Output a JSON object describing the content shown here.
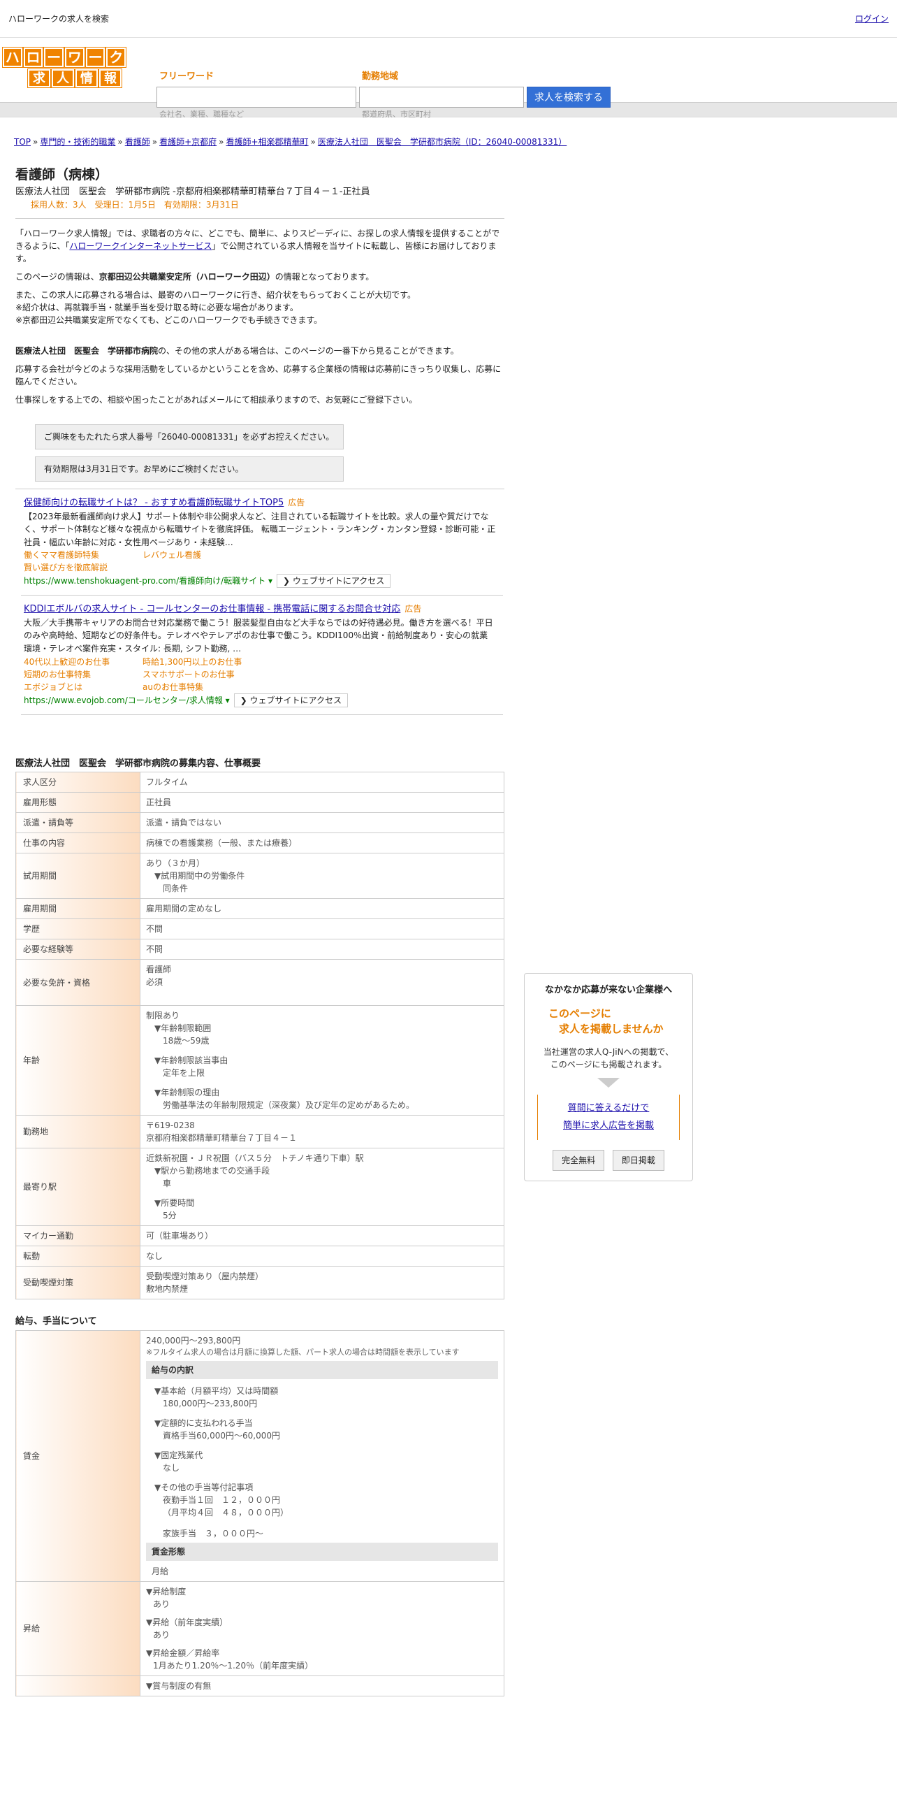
{
  "topbar": {
    "title": "ハローワークの求人を検索",
    "login": "ログイン"
  },
  "logo": {
    "row1": [
      "ハ",
      "ロ",
      "ー",
      "ワ",
      "ー",
      "ク"
    ],
    "row2": [
      "求",
      "人",
      "情",
      "報"
    ]
  },
  "search": {
    "keyword_label": "フリーワード",
    "keyword_hint": "会社名、業種、職種など",
    "area_label": "勤務地域",
    "area_hint": "都道府県、市区町村",
    "button": "求人を検索する"
  },
  "breadcrumb": [
    "TOP",
    "専門的・技術的職業",
    "看護師",
    "看護師+京都府",
    "看護師+相楽郡精華町",
    "医療法人社団　医聖会　学研都市病院（ID：26040-00081331）"
  ],
  "job": {
    "title": "看護師（病棟）",
    "company_line": "医療法人社団　医聖会　学研都市病院 -京都府相楽郡精華町精華台７丁目４－１-正社員",
    "meta": "採用人数：3人　受理日：1月5日　有効期限：3月31日"
  },
  "intro": {
    "p1a": "「ハローワーク求人情報」では、求職者の方々に、どこでも、簡単に、よりスピーディに、お探しの求人情報を提供することができるように、「",
    "p1link": "ハローワークインターネットサービス",
    "p1b": "」で公開されている求人情報を当サイトに転載し、皆様にお届けしております。",
    "p2a": "このページの情報は、",
    "p2b": "京都田辺公共職業安定所（ハローワーク田辺）",
    "p2c": "の情報となっております。",
    "p3": "また、この求人に応募される場合は、最寄のハローワークに行き、紹介状をもらっておくことが大切です。",
    "p4": "※紹介状は、再就職手当・就業手当を受け取る時に必要な場合があります。",
    "p5": "※京都田辺公共職業安定所でなくても、どこのハローワークでも手続きできます。",
    "p6a": "医療法人社団　医聖会　学研都市病院",
    "p6b": "の、その他の求人がある場合は、このページの一番下から見ることができます。",
    "p7": "応募する会社が今どのような採用活動をしているかということを含め、応募する企業様の情報は応募前にきっちり収集し、応募に臨んでください。",
    "p8": "仕事探しをする上での、相談や困ったことがあればメールにて相談承りますので、お気軽にご登録下さい。"
  },
  "notices": [
    "ご興味をもたれたら求人番号「26040-00081331」を必ずお控えください。",
    "有効期限は3月31日です。お早めにご検討ください。"
  ],
  "ads": [
    {
      "title": "保健師向けの転職サイトは？ - おすすめ看護師転職サイトTOP5",
      "tag": "広告",
      "desc": "【2023年最新看護師向け求人】サポート体制や非公開求人など、注目されている転職サイトを比較。求人の量や質だけでなく、サポート体制など様々な視点から転職サイトを徹底評価。 転職エージェント・ランキング・カンタン登録・診断可能・正社員・幅広い年齢に対応・女性用ページあり・未経験…",
      "links": [
        "働くママ看護師特集",
        "レバウェル看護",
        "賢い選び方を徹底解説"
      ],
      "url": "https://www.tenshokuagent-pro.com/看護師向け/転職サイト ▾",
      "button": "❯ ウェブサイトにアクセス"
    },
    {
      "title": "KDDIエボルバの求人サイト - コールセンターのお仕事情報 - 携帯電話に関するお問合せ対応",
      "tag": "広告",
      "desc": "大阪／大手携帯キャリアのお問合せ対応業務で働こう！服装髪型自由など大手ならではの好待遇必見。働き方を選べる！平日のみや高時給、短期などの好条件も。テレオペやテレアポのお仕事で働こう。KDDI100％出資・前給制度あり・安心の就業環境・テレオペ案件充実・スタイル: 長期, シフト勤務, …",
      "links": [
        "40代以上歓迎のお仕事",
        "時給1,300円以上のお仕事",
        "短期のお仕事特集",
        "スマホサポートのお仕事",
        "エボジョブとは",
        "auのお仕事特集"
      ],
      "url": "https://www.evojob.com/コールセンター/求人情報 ▾",
      "button": "❯ ウェブサイトにアクセス"
    }
  ],
  "section1": "医療法人社団　医聖会　学研都市病院の募集内容、仕事概要",
  "rows": {
    "r1": {
      "h": "求人区分",
      "v": "フルタイム"
    },
    "r2": {
      "h": "雇用形態",
      "v": "正社員"
    },
    "r3": {
      "h": "派遣・請負等",
      "v": "派遣・請負ではない"
    },
    "r4": {
      "h": "仕事の内容",
      "v": "病棟での看護業務（一般、または療養）"
    },
    "r5": {
      "h": "試用期間",
      "v": "あり（３か月）",
      "s1": "▼試用期間中の労働条件",
      "s2": "同条件"
    },
    "r6": {
      "h": "雇用期間",
      "v": "雇用期間の定めなし"
    },
    "r7": {
      "h": "学歴",
      "v": "不問"
    },
    "r8": {
      "h": "必要な経験等",
      "v": "不問"
    },
    "r9": {
      "h": "必要な免許・資格",
      "v": "看護師",
      "v2": "必須"
    },
    "r10": {
      "h": "年齢",
      "v": "制限あり",
      "s1": "▼年齢制限範囲",
      "s2": "18歳〜59歳",
      "s3": "▼年齢制限該当事由",
      "s4": "定年を上限",
      "s5": "▼年齢制限の理由",
      "s6": "労働基準法の年齢制限規定（深夜業）及び定年の定めがあるため。"
    },
    "r11": {
      "h": "勤務地",
      "v": "〒619-0238",
      "v2": "京都府相楽郡精華町精華台７丁目４－１"
    },
    "r12": {
      "h": "最寄り駅",
      "v": "近鉄新祝園・ＪＲ祝園（バス５分　トチノキ通り下車）駅",
      "s1": "▼駅から勤務地までの交通手段",
      "s2": "車",
      "s3": "▼所要時間",
      "s4": "5分"
    },
    "r13": {
      "h": "マイカー通勤",
      "v": "可（駐車場あり）"
    },
    "r14": {
      "h": "転勤",
      "v": "なし"
    },
    "r15": {
      "h": "受動喫煙対策",
      "v": "受動喫煙対策あり（屋内禁煙）",
      "v2": "敷地内禁煙"
    }
  },
  "section2": "給与、手当について",
  "pay": {
    "h": "賃金",
    "v": "240,000円〜293,800円",
    "note": "※フルタイム求人の場合は月額に換算した額、パート求人の場合は時間額を表示しています",
    "box1": "給与の内訳",
    "a1": "▼基本給（月額平均）又は時間額",
    "a2": "180,000円〜233,800円",
    "b1": "▼定額的に支払われる手当",
    "b2": "資格手当60,000円〜60,000円",
    "c1": "▼固定残業代",
    "c2": "なし",
    "d1": "▼その他の手当等付記事項",
    "d2": "夜勤手当１回　１２，０００円",
    "d3": "（月平均４回　４８，０００円）",
    "d4": "家族手当　３，０００円～",
    "box2": "賃金形態",
    "form": "月給"
  },
  "raise": {
    "h": "昇給",
    "a1": "▼昇給制度",
    "a2": "あり",
    "b1": "▼昇給（前年度実績）",
    "b2": "あり",
    "c1": "▼昇給金額／昇給率",
    "c2": "1月あたり1.20％〜1.20％（前年度実績）"
  },
  "bonus": {
    "a1": "▼賞与制度の有無"
  },
  "side": {
    "heading": "なかなか応募が来ない企業様へ",
    "o1": "このページに",
    "o2": "　求人を掲載しませんか",
    "t1": "当社運営の求人Q-JiNへの掲載で、",
    "t2": "このページにも掲載されます。",
    "l1": "質問に答えるだけで",
    "l2": "簡単に求人広告を掲載",
    "b1": "完全無料",
    "b2": "即日掲載"
  }
}
